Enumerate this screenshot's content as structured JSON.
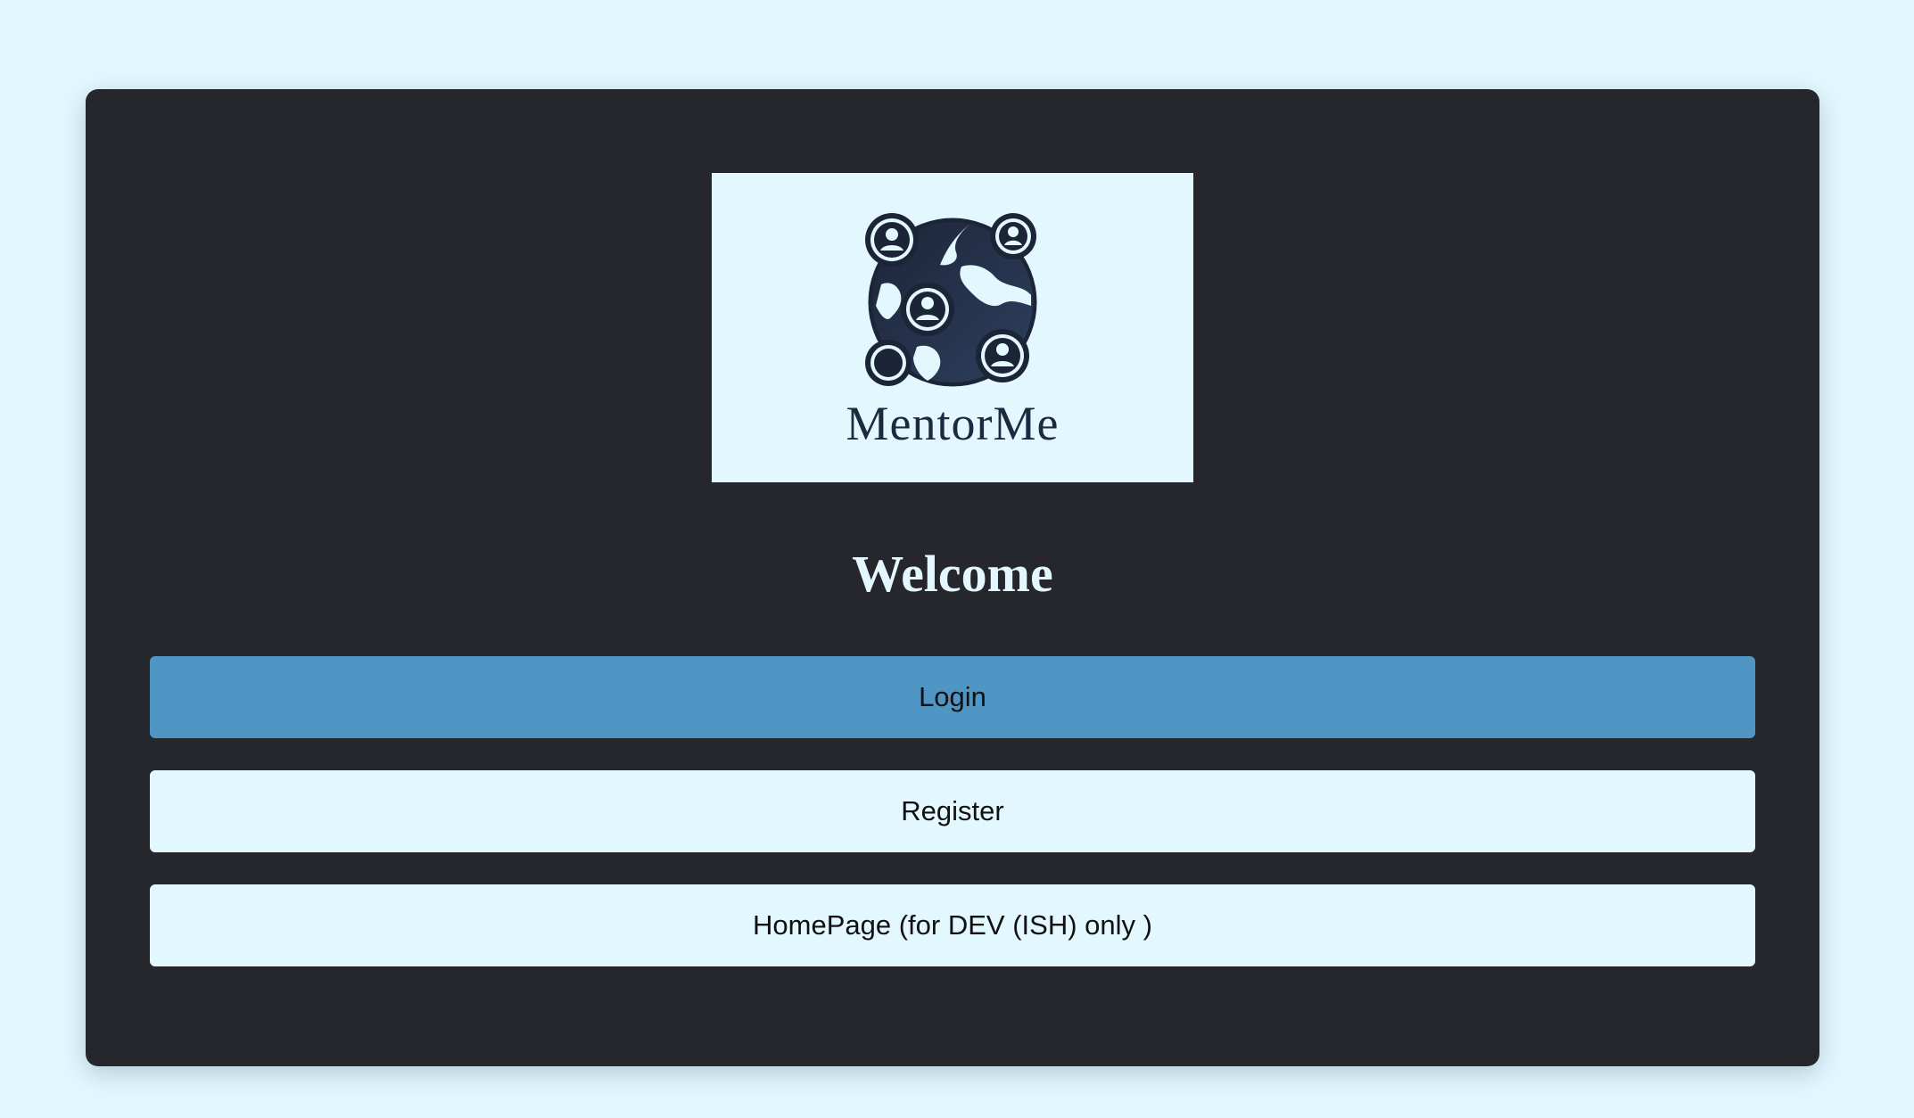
{
  "logo": {
    "text": "MentorMe",
    "icon": "globe-people-icon"
  },
  "heading": "Welcome",
  "buttons": {
    "login": "Login",
    "register": "Register",
    "homepage": "HomePage (for DEV (ISH) only )"
  },
  "colors": {
    "page_background": "#e3f7fe",
    "card_background": "#25272d",
    "primary_button": "#4f96c4",
    "secondary_button": "#e3f7fe",
    "logo_ink": "#1c2a40"
  }
}
